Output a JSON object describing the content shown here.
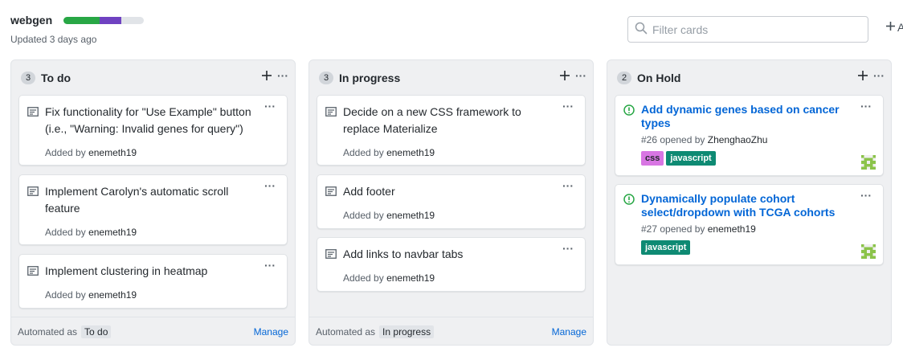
{
  "project": {
    "name": "webgen",
    "updated": "Updated 3 days ago",
    "progress": {
      "done_fraction": 0.45,
      "in_progress_fraction": 0.27,
      "done_color": "#28a745",
      "in_progress_color": "#6f42c1",
      "todo_color": "#e1e4e8"
    }
  },
  "search": {
    "placeholder": "Filter cards",
    "value": ""
  },
  "add_column": {
    "label": "+ A",
    "icon": "plus-icon"
  },
  "columns": [
    {
      "title": "To do",
      "count": "3",
      "automated_label": "Automated as",
      "automated_value": "To do",
      "manage_label": "Manage",
      "cards": [
        {
          "type": "note",
          "icon": "note-icon",
          "title": "Fix functionality for \"Use Example\" button (i.e., \"Warning: Invalid genes for query\")",
          "added_prefix": "Added by",
          "user": "enemeth19"
        },
        {
          "type": "note",
          "icon": "note-icon",
          "title": "Implement Carolyn's automatic scroll feature",
          "added_prefix": "Added by",
          "user": "enemeth19"
        },
        {
          "type": "note",
          "icon": "note-icon",
          "title": "Implement clustering in heatmap",
          "added_prefix": "Added by",
          "user": "enemeth19"
        }
      ]
    },
    {
      "title": "In progress",
      "count": "3",
      "automated_label": "Automated as",
      "automated_value": "In progress",
      "manage_label": "Manage",
      "cards": [
        {
          "type": "note",
          "icon": "note-icon",
          "title": "Decide on a new CSS framework to replace Materialize",
          "added_prefix": "Added by",
          "user": "enemeth19"
        },
        {
          "type": "note",
          "icon": "note-icon",
          "title": "Add footer",
          "added_prefix": "Added by",
          "user": "enemeth19"
        },
        {
          "type": "note",
          "icon": "note-icon",
          "title": "Add links to navbar tabs",
          "added_prefix": "Added by",
          "user": "enemeth19"
        }
      ]
    },
    {
      "title": "On Hold",
      "count": "2",
      "cards": [
        {
          "type": "issue",
          "icon": "issue-opened-icon",
          "title": "Add dynamic genes based on cancer types",
          "meta_prefix": "#26 opened by",
          "user": "ZhenghaoZhu",
          "labels": [
            {
              "name": "css",
              "color": "#d876e3",
              "text_color": "#24292e"
            },
            {
              "name": "javascript",
              "color": "#0e8a73",
              "text_color": "#ffffff"
            }
          ]
        },
        {
          "type": "issue",
          "icon": "issue-opened-icon",
          "title": "Dynamically populate cohort select/dropdown with TCGA cohorts",
          "meta_prefix": "#27 opened by",
          "user": "enemeth19",
          "labels": [
            {
              "name": "javascript",
              "color": "#0e8a73",
              "text_color": "#ffffff"
            }
          ]
        }
      ]
    }
  ],
  "colors": {
    "link": "#0366d6",
    "issue_open": "#28a745",
    "avatar": "#8bc34a"
  }
}
